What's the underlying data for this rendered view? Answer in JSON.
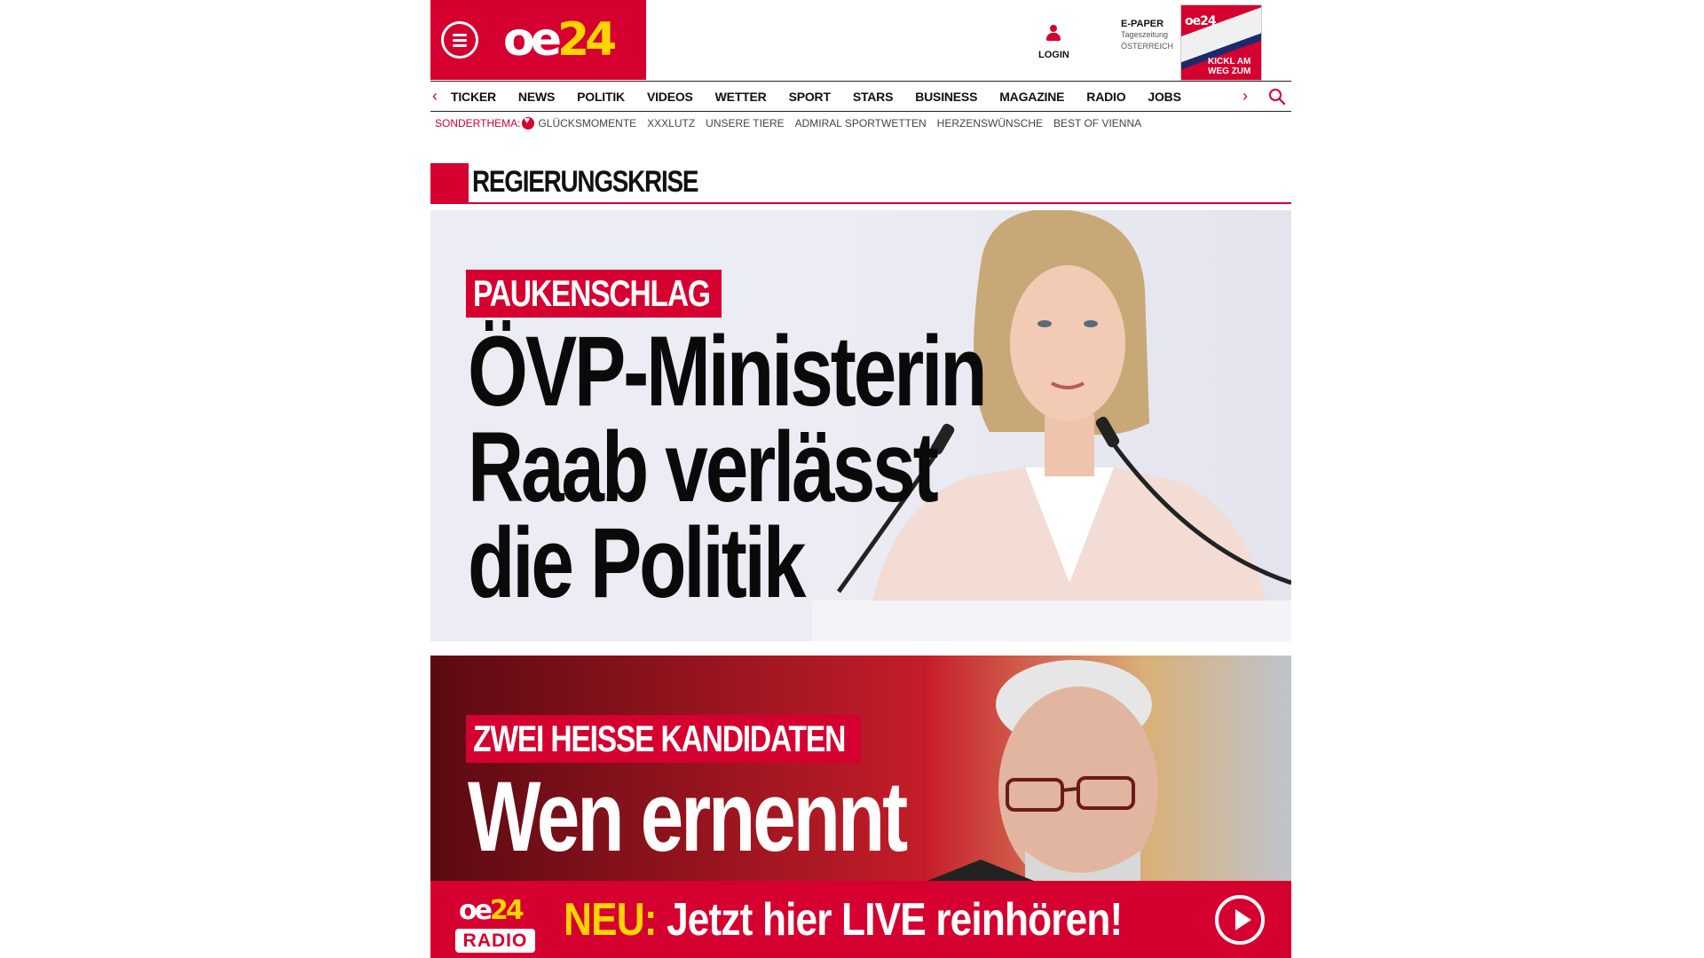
{
  "header": {
    "brand_oe": "oe",
    "brand_num": "24",
    "login_label": "LOGIN",
    "epaper_title": "E-PAPER",
    "epaper_sub1": "Tageszeitung",
    "epaper_sub2": "ÖSTERREICH",
    "epaper_cover_logo": "oe24",
    "epaper_cover_headline": "KICKL AM WEG ZUM"
  },
  "nav": {
    "items": [
      "TICKER",
      "NEWS",
      "POLITIK",
      "VIDEOS",
      "WETTER",
      "SPORT",
      "STARS",
      "BUSINESS",
      "MAGAZINE",
      "RADIO",
      "JOBS"
    ]
  },
  "topics": {
    "label": "SONDERTHEMA:",
    "items": [
      "GLÜCKSMOMENTE",
      "XXXLUTZ",
      "UNSERE TIERE",
      "ADMIRAL SPORTWETTEN",
      "HERZENSWÜNSCHE",
      "BEST OF VIENNA"
    ]
  },
  "section": {
    "title": "REGIERUNGSKRISE"
  },
  "stories": [
    {
      "kicker": "PAUKENSCHLAG",
      "headline_lines": [
        "ÖVP-Ministerin",
        "Raab verlässt",
        "die Politik"
      ]
    },
    {
      "kicker": "ZWEI HEISSE KANDIDATEN",
      "headline_lines": [
        "Wen ernennt"
      ]
    }
  ],
  "radio": {
    "logo_oe": "oe",
    "logo_num": "24",
    "logo_sub": "RADIO",
    "neu": "NEU:",
    "text": "Jetzt hier LIVE reinhören!"
  },
  "colors": {
    "brand_red": "#d5002f",
    "brand_yellow": "#ffd400"
  }
}
